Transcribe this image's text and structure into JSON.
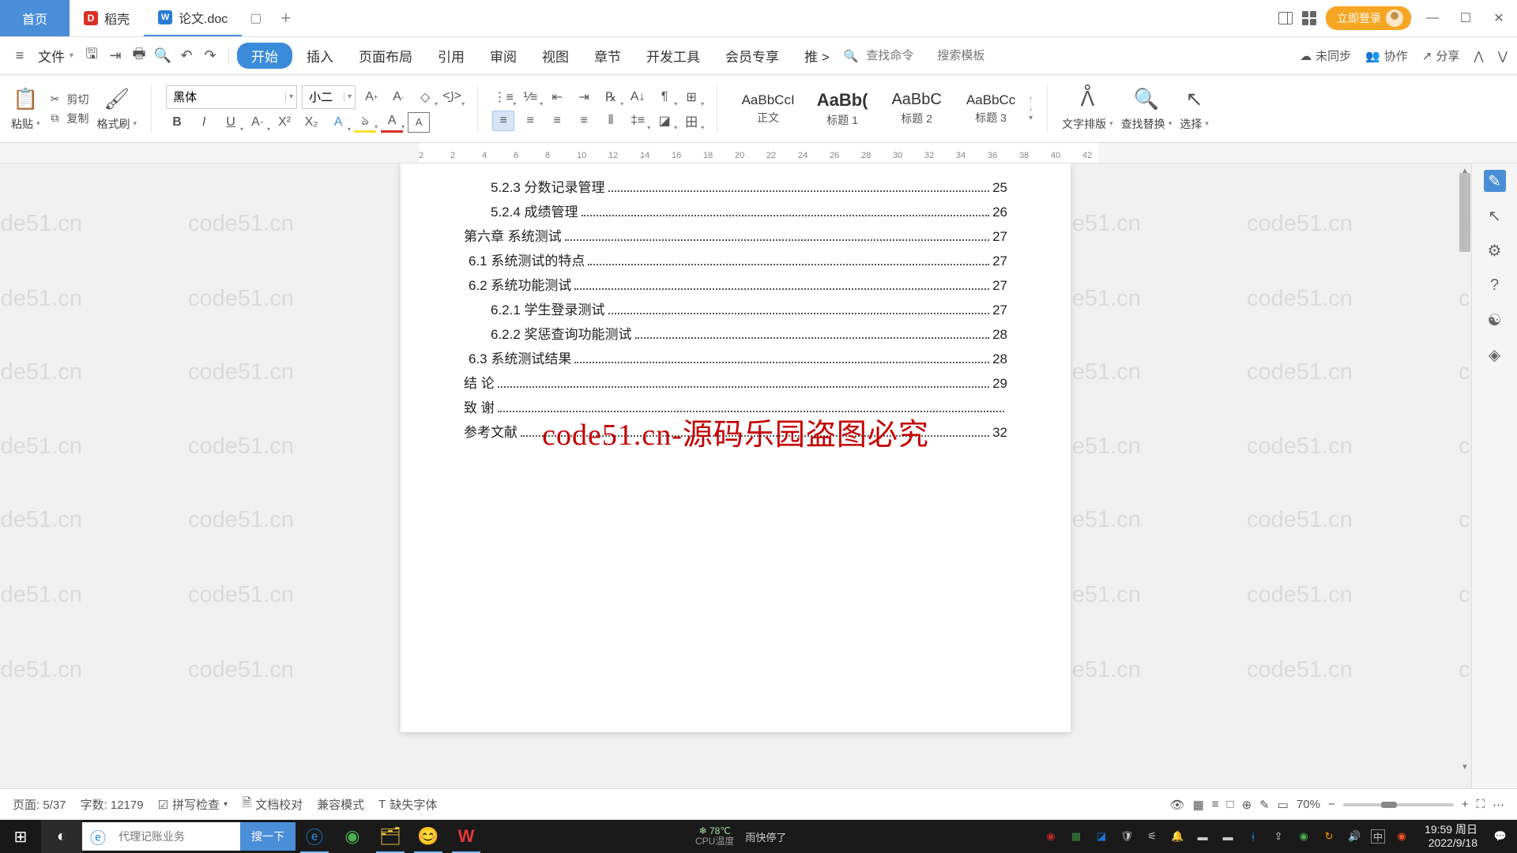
{
  "tabs": {
    "home": "首页",
    "doke": "稻壳",
    "doc": "论文.doc"
  },
  "titlebar": {
    "login": "立即登录"
  },
  "menubar": {
    "file": "文件",
    "items": [
      "开始",
      "插入",
      "页面布局",
      "引用",
      "审阅",
      "视图",
      "章节",
      "开发工具",
      "会员专享",
      "推"
    ],
    "search_cmd": "查找命令",
    "search_tpl": "搜索模板",
    "unsync": "未同步",
    "collab": "协作",
    "share": "分享"
  },
  "ribbon": {
    "paste": "粘贴",
    "cut": "剪切",
    "copy": "复制",
    "format_painter": "格式刷",
    "font_name": "黑体",
    "font_size": "小二",
    "styles": [
      {
        "preview": "AaBbCcI",
        "label": "正文"
      },
      {
        "preview": "AaBb(",
        "label": "标题 1"
      },
      {
        "preview": "AaBbC",
        "label": "标题 2"
      },
      {
        "preview": "AaBbCc",
        "label": "标题 3"
      }
    ],
    "text_layout": "文字排版",
    "find_replace": "查找替换",
    "select": "选择"
  },
  "ruler_ticks": [
    "2",
    "2",
    "4",
    "6",
    "8",
    "10",
    "12",
    "14",
    "16",
    "18",
    "20",
    "22",
    "24",
    "26",
    "28",
    "30",
    "32",
    "34",
    "36",
    "38",
    "40",
    "42"
  ],
  "toc": [
    {
      "indent": 1,
      "num": "5.2.3",
      "title": "分数记录管理",
      "page": "25"
    },
    {
      "indent": 1,
      "num": "5.2.4",
      "title": "成绩管理",
      "page": "26"
    },
    {
      "indent": 2,
      "num": "第六章",
      "title": "系统测试",
      "page": "27"
    },
    {
      "indent": 3,
      "num": "6.1",
      "title": "系统测试的特点",
      "page": "27"
    },
    {
      "indent": 3,
      "num": "6.2",
      "title": "系统功能测试",
      "page": "27"
    },
    {
      "indent": 1,
      "num": "6.2.1",
      "title": "学生登录测试",
      "page": "27"
    },
    {
      "indent": 1,
      "num": "6.2.2",
      "title": "奖惩查询功能测试",
      "page": "28"
    },
    {
      "indent": 3,
      "num": "6.3",
      "title": "系统测试结果",
      "page": "28"
    },
    {
      "indent": 2,
      "num": "结",
      "title": "论",
      "page": "29"
    },
    {
      "indent": 2,
      "num": "致",
      "title": "谢",
      "page": ""
    },
    {
      "indent": 2,
      "num": "",
      "title": "参考文献",
      "page": "32"
    }
  ],
  "watermark_main": "code51.cn-源码乐园盗图必究",
  "watermark_bg": "code51.cn",
  "status": {
    "page": "页面: 5/37",
    "words": "字数: 12179",
    "spell": "拼写检查",
    "proof": "文档校对",
    "compat": "兼容模式",
    "missing_font": "缺失字体",
    "zoom": "70%"
  },
  "taskbar": {
    "search_placeholder": "代理记账业务",
    "search_btn": "搜一下",
    "temp": "78℃",
    "temp_label": "CPU温度",
    "weather_top": "雨快停了",
    "time": "19:59",
    "day": "周日",
    "date": "2022/9/18",
    "ime": "中"
  }
}
